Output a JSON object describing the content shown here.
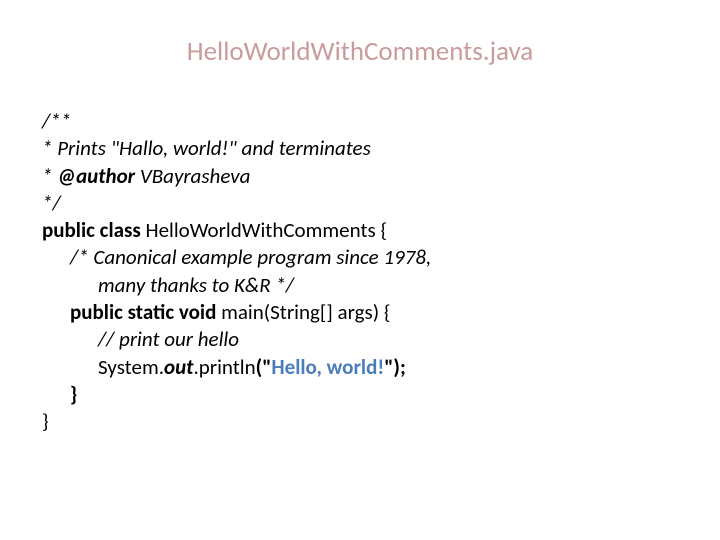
{
  "title": "HelloWorldWithComments.java",
  "code": {
    "l1": "/**",
    "l2": " * Prints \"Hallo, world!\" and terminates",
    "l3_a": " * ",
    "l3_b": "@author",
    "l3_c": " VBayrasheva",
    "l4": " */",
    "l5_a": "public class ",
    "l5_b": "HelloWorldWithComments {",
    "l6": "/* Canonical example program since 1978,",
    "l7": "many thanks to K&R */",
    "l8_a": "public static void ",
    "l8_b": "main(String[] args) {",
    "l9": "// print our hello",
    "l10_a": " System.",
    "l10_b": "out",
    "l10_c": ".println",
    "l10_d": "(\"",
    "l10_e": "Hello, world!",
    "l10_f": "\");",
    "l11": "}",
    "l12": "}"
  }
}
